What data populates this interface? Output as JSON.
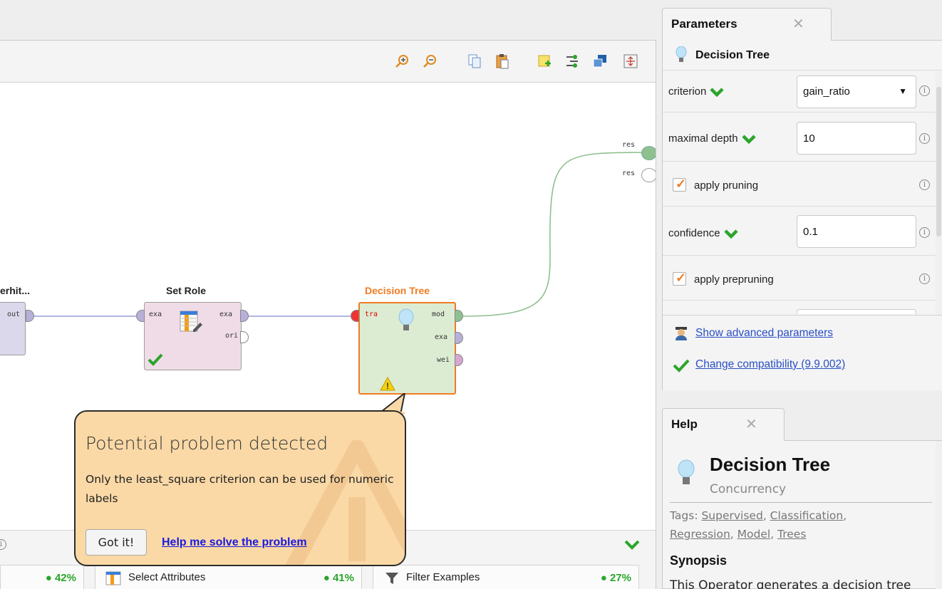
{
  "process": {
    "outputs": [
      "res",
      "res"
    ],
    "operators": {
      "retrieve": {
        "title": "erhit...",
        "port_out": "out"
      },
      "set_role": {
        "title": "Set Role",
        "ports_in": [
          "exa"
        ],
        "ports_out": [
          "exa",
          "ori"
        ]
      },
      "decision_tree": {
        "title": "Decision Tree",
        "ports_in": [
          "tra"
        ],
        "ports_out": [
          "mod",
          "exa",
          "wei"
        ]
      }
    }
  },
  "popup": {
    "title": "Potential problem detected",
    "message": "Only the least_square criterion can be used for numeric labels",
    "got_it": "Got it!",
    "help_link": "Help me solve the problem"
  },
  "recommendations": [
    {
      "label": "",
      "pct": "42%"
    },
    {
      "label": "Select Attributes",
      "pct": "41%"
    },
    {
      "label": "Filter Examples",
      "pct": "27%"
    }
  ],
  "parameters": {
    "tab_label": "Parameters",
    "operator_name": "Decision Tree",
    "criterion_label": "criterion",
    "criterion_value": "gain_ratio",
    "maximal_depth_label": "maximal depth",
    "maximal_depth_value": "10",
    "apply_pruning_label": "apply pruning",
    "confidence_label": "confidence",
    "confidence_value": "0.1",
    "apply_prepruning_label": "apply prepruning",
    "show_advanced": "Show advanced parameters",
    "change_compat": "Change compatibility (9.9.002)"
  },
  "help": {
    "tab_label": "Help",
    "title": "Decision Tree",
    "subtitle": "Concurrency",
    "tags_prefix": "Tags: ",
    "tags": [
      "Supervised",
      "Classification",
      "Regression",
      "Model",
      "Trees"
    ],
    "synopsis_heading": "Synopsis",
    "synopsis_text": "This Operator generates a decision tree"
  },
  "colors": {
    "accent_orange": "#f07b22",
    "ok_green": "#2aa52a",
    "link_blue": "#2a4fc5"
  }
}
